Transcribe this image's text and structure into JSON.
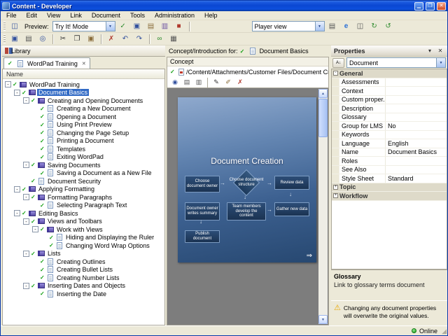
{
  "window": {
    "title": "Content - Developer",
    "status_online": "Online",
    "controls": [
      {
        "name": "minimize-button",
        "glyph": "▁"
      },
      {
        "name": "maximize-button",
        "glyph": "❒"
      },
      {
        "name": "close-button",
        "glyph": "✕"
      }
    ]
  },
  "ui": {
    "check": "✓",
    "minus": "-",
    "plus": "+",
    "combo_arrow": "▼",
    "close": "✕",
    "next_arrow": "⇒",
    "sb_up": "▲",
    "sb_down": "▼",
    "warning": "⚠",
    "grip": "◢"
  },
  "menubar": {
    "items": [
      "File",
      "Edit",
      "View",
      "Link",
      "Document",
      "Tools",
      "Administration",
      "Help"
    ]
  },
  "toolbar_top": {
    "preview_label": "Preview:",
    "preview_combo": "Try It! Mode",
    "player_combo": "Player view",
    "left_buttons": [
      {
        "name": "preview-mode-icon",
        "glyph": "◫",
        "color": "#33519e"
      }
    ],
    "mid_buttons": [
      {
        "name": "try-it-check-icon",
        "glyph": "✓",
        "color": "#2e8b2e"
      },
      {
        "name": "demo-monitor-icon",
        "glyph": "▣",
        "color": "#33519e"
      },
      {
        "name": "assess-mode-icon",
        "glyph": "▤",
        "color": "#8a6d3b"
      },
      {
        "name": "print-mode-icon",
        "glyph": "▥",
        "color": "#6a4fa0"
      },
      {
        "name": "stop-preview-icon",
        "glyph": "■",
        "color": "#b03a2e"
      }
    ],
    "right_buttons": [
      {
        "name": "export-page-icon",
        "glyph": "▤",
        "color": "#555555"
      },
      {
        "name": "internet-explorer-icon",
        "glyph": "e",
        "color": "#2a6fd6",
        "bold": true
      },
      {
        "name": "browser-preview-icon",
        "glyph": "◫",
        "color": "#555555"
      },
      {
        "name": "refresh-icon",
        "glyph": "↻",
        "color": "#2e8b2e"
      },
      {
        "name": "sync-icon",
        "glyph": "↺",
        "color": "#2e8b2e"
      }
    ]
  },
  "toolbar_edit": {
    "buttons": [
      {
        "name": "save-icon",
        "glyph": "▣",
        "color": "#33519e"
      },
      {
        "name": "print-icon",
        "glyph": "▤",
        "color": "#555555"
      },
      {
        "name": "search-icon",
        "glyph": "◎",
        "color": "#33519e"
      },
      {
        "sep": true
      },
      {
        "name": "cut-icon",
        "glyph": "✂",
        "color": "#333333"
      },
      {
        "name": "copy-icon",
        "glyph": "❐",
        "color": "#333333"
      },
      {
        "name": "paste-icon",
        "glyph": "▣",
        "color": "#8a6d3b"
      },
      {
        "sep": true
      },
      {
        "name": "delete-icon",
        "glyph": "✗",
        "color": "#b03a2e"
      },
      {
        "name": "undo-icon",
        "glyph": "↶",
        "color": "#33519e"
      },
      {
        "name": "redo-icon",
        "glyph": "↷",
        "color": "#33519e"
      },
      {
        "sep": true
      },
      {
        "name": "link-icon",
        "glyph": "∞",
        "color": "#2e8b2e"
      },
      {
        "name": "properties-icon",
        "glyph": "▦",
        "color": "#555555"
      }
    ]
  },
  "library_panel": {
    "header": "Library",
    "tab": "WordPad Training",
    "tree_header": "Name",
    "tree": [
      {
        "label": "WordPad Training",
        "level": 0,
        "icon": "book",
        "expander": true,
        "checked": true
      },
      {
        "label": "Document Basics",
        "level": 1,
        "icon": "book",
        "expander": true,
        "checked": true,
        "selected": true
      },
      {
        "label": "Creating and Opening Documents",
        "level": 2,
        "icon": "book",
        "expander": true,
        "checked": true
      },
      {
        "label": "Creating a New Document",
        "level": 3,
        "icon": "page",
        "checked": true
      },
      {
        "label": "Opening a Document",
        "level": 3,
        "icon": "page",
        "checked": true
      },
      {
        "label": "Using Print Preview",
        "level": 3,
        "icon": "page",
        "checked": true
      },
      {
        "label": "Changing the Page Setup",
        "level": 3,
        "icon": "page",
        "checked": true
      },
      {
        "label": "Printing a Document",
        "level": 3,
        "icon": "page",
        "checked": true
      },
      {
        "label": "Templates",
        "level": 3,
        "icon": "page",
        "checked": true
      },
      {
        "label": "Exiting WordPad",
        "level": 3,
        "icon": "page",
        "checked": true
      },
      {
        "label": "Saving Documents",
        "level": 2,
        "icon": "book",
        "expander": true,
        "checked": true
      },
      {
        "label": "Saving a Document as a New File",
        "level": 3,
        "icon": "page",
        "checked": true
      },
      {
        "label": "Document Security",
        "level": 2,
        "icon": "page",
        "checked": true
      },
      {
        "label": "Applying Formatting",
        "level": 1,
        "icon": "book",
        "expander": true,
        "checked": true
      },
      {
        "label": "Formatting Paragraphs",
        "level": 2,
        "icon": "book",
        "expander": true,
        "checked": true
      },
      {
        "label": "Selecting Paragraph Text",
        "level": 3,
        "icon": "page",
        "checked": true
      },
      {
        "label": "Editing Basics",
        "level": 1,
        "icon": "book",
        "expander": true,
        "checked": true
      },
      {
        "label": "Views and Toolbars",
        "level": 2,
        "icon": "book",
        "expander": true,
        "checked": true
      },
      {
        "label": "Work with Views",
        "level": 3,
        "icon": "book",
        "expander": true,
        "checked": true
      },
      {
        "label": "Hiding and Displaying the Ruler",
        "level": 4,
        "icon": "page",
        "checked": true
      },
      {
        "label": "Changing Word Wrap Options",
        "level": 4,
        "icon": "page",
        "checked": true
      },
      {
        "label": "Lists",
        "level": 2,
        "icon": "book",
        "expander": true,
        "checked": true
      },
      {
        "label": "Creating Outlines",
        "level": 3,
        "icon": "page",
        "checked": true
      },
      {
        "label": "Creating Bullet Lists",
        "level": 3,
        "icon": "page",
        "checked": true
      },
      {
        "label": "Creating Number Lists",
        "level": 3,
        "icon": "page",
        "checked": true
      },
      {
        "label": "Inserting Dates and Objects",
        "level": 2,
        "icon": "book",
        "expander": true,
        "checked": true
      },
      {
        "label": "Inserting the Date",
        "level": 3,
        "icon": "page",
        "checked": true
      }
    ]
  },
  "content_panel": {
    "header_label": "Concept/Introduction for:",
    "header_doc": "Document Basics",
    "section_label": "Concept",
    "attachment_path": "/Content/Attachments/Customer Files/Document Creation.pdf",
    "attachment_buttons": [
      {
        "name": "view-attachment-icon",
        "glyph": "◉",
        "color": "#33519e"
      },
      {
        "name": "open-attachment-icon",
        "glyph": "▤",
        "color": "#555555"
      },
      {
        "name": "print-attachment-icon",
        "glyph": "▥",
        "color": "#555555"
      },
      {
        "sep": true
      },
      {
        "name": "edit-attachment-icon",
        "glyph": "✎",
        "color": "#333333"
      },
      {
        "name": "replace-attachment-icon",
        "glyph": "✐",
        "color": "#8a6d3b"
      },
      {
        "name": "remove-attachment-icon",
        "glyph": "✗",
        "color": "#b03a2e"
      }
    ],
    "slide": {
      "title": "Document Creation",
      "boxes": [
        {
          "text": "Choose document owner"
        },
        {
          "text": "Choose document structure",
          "shape": "diamond"
        },
        {
          "text": "Review data"
        },
        {
          "text": "Document owner writes summary"
        },
        {
          "text": "Team members develop the content"
        },
        {
          "text": "Gather new data"
        },
        {
          "text": "Publish document"
        }
      ],
      "arrows": [
        "right",
        "right",
        "down",
        "down",
        "right",
        "down"
      ]
    }
  },
  "properties_panel": {
    "title": "Properties",
    "sort_icon_glyph": "A↓",
    "object_combo": "Document",
    "window_buttons": [
      {
        "name": "window-menu-icon",
        "glyph": "▾"
      },
      {
        "name": "close-icon",
        "glyph": "✕"
      }
    ],
    "rows": [
      {
        "kind": "category",
        "label": "General",
        "expanded": true
      },
      {
        "kind": "prop",
        "label": "Assessments",
        "value": ""
      },
      {
        "kind": "prop",
        "label": "Context",
        "value": ""
      },
      {
        "kind": "prop",
        "label": "Custom proper...",
        "value": ""
      },
      {
        "kind": "prop",
        "label": "Description",
        "value": ""
      },
      {
        "kind": "prop",
        "label": "Glossary",
        "value": ""
      },
      {
        "kind": "prop",
        "label": "Group for LMS",
        "value": "No"
      },
      {
        "kind": "prop",
        "label": "Keywords",
        "value": ""
      },
      {
        "kind": "prop",
        "label": "Language",
        "value": "English"
      },
      {
        "kind": "prop",
        "label": "Name",
        "value": "Document Basics"
      },
      {
        "kind": "prop",
        "label": "Roles",
        "value": ""
      },
      {
        "kind": "prop",
        "label": "See Also",
        "value": ""
      },
      {
        "kind": "prop",
        "label": "Style Sheet",
        "value": "Standard"
      },
      {
        "kind": "category",
        "label": "Topic",
        "expanded": false
      },
      {
        "kind": "category",
        "label": "Workflow",
        "expanded": false
      }
    ],
    "help_title": "Glossary",
    "help_text": "Link to glossary terms document",
    "warning": "Changing any document properties will overwrite the original values."
  },
  "colors": {
    "selection": "#316ac5",
    "titlebar": "#0a47d2",
    "panel_bg": "#ece9d8",
    "preview_bg": "#7d7d7d",
    "slide_blue": "#3d6191",
    "check_green": "#16a016",
    "warning_yellow": "#e8a800"
  }
}
